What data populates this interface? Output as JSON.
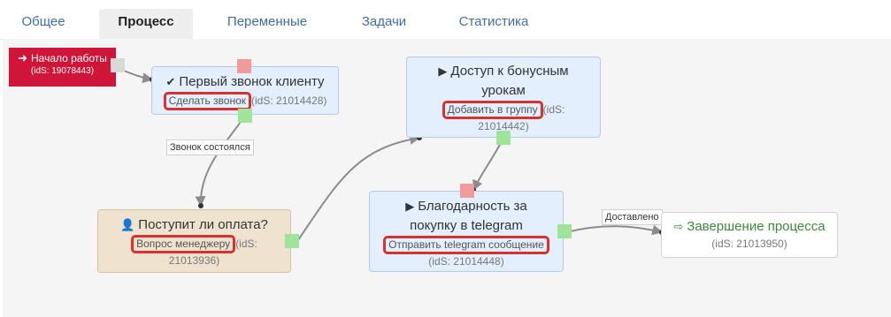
{
  "tabs": [
    {
      "label": "Общее",
      "active": false
    },
    {
      "label": "Процесс",
      "active": true
    },
    {
      "label": "Переменные",
      "active": false
    },
    {
      "label": "Задачи",
      "active": false
    },
    {
      "label": "Статистика",
      "active": false
    }
  ],
  "start": {
    "title": "Начало работы",
    "ids": "(idS: 19078443)",
    "icon": "sign-in-icon"
  },
  "nodes": {
    "first_call": {
      "title": "Первый звонок клиенту",
      "action": "Сделать звонок",
      "ids_a": "(idS: 21014428)",
      "icon": "check-icon"
    },
    "bonus": {
      "title_1": "Доступ к бонусным",
      "title_2": "урокам",
      "action": "Добавить в группу",
      "ids_a": "(idS:",
      "ids_b": "21014442)",
      "icon": "play-icon"
    },
    "payment": {
      "title": "Поступит ли оплата?",
      "action": "Вопрос менеджеру",
      "ids_a": "(idS:",
      "ids_b": "21013936)",
      "icon": "user-icon"
    },
    "thanks": {
      "title_1": "Благодарность за",
      "title_2": "покупку в telegram",
      "action": "Отправить telegram сообщение",
      "ids_a": "(idS: 21014448)",
      "icon": "play-icon"
    },
    "finish": {
      "title": "Завершение процесса",
      "ids": "(idS: 21013950)",
      "icon": "sign-out-icon"
    }
  },
  "labels": {
    "call_done": "Звонок состоялся",
    "delivered": "Доставлено"
  },
  "colors": {
    "start": "#cf1638",
    "highlight": "#d93030",
    "node_blue": "#e3effc",
    "node_beige": "#efe3d0",
    "finish_text": "#3b8a3b"
  }
}
